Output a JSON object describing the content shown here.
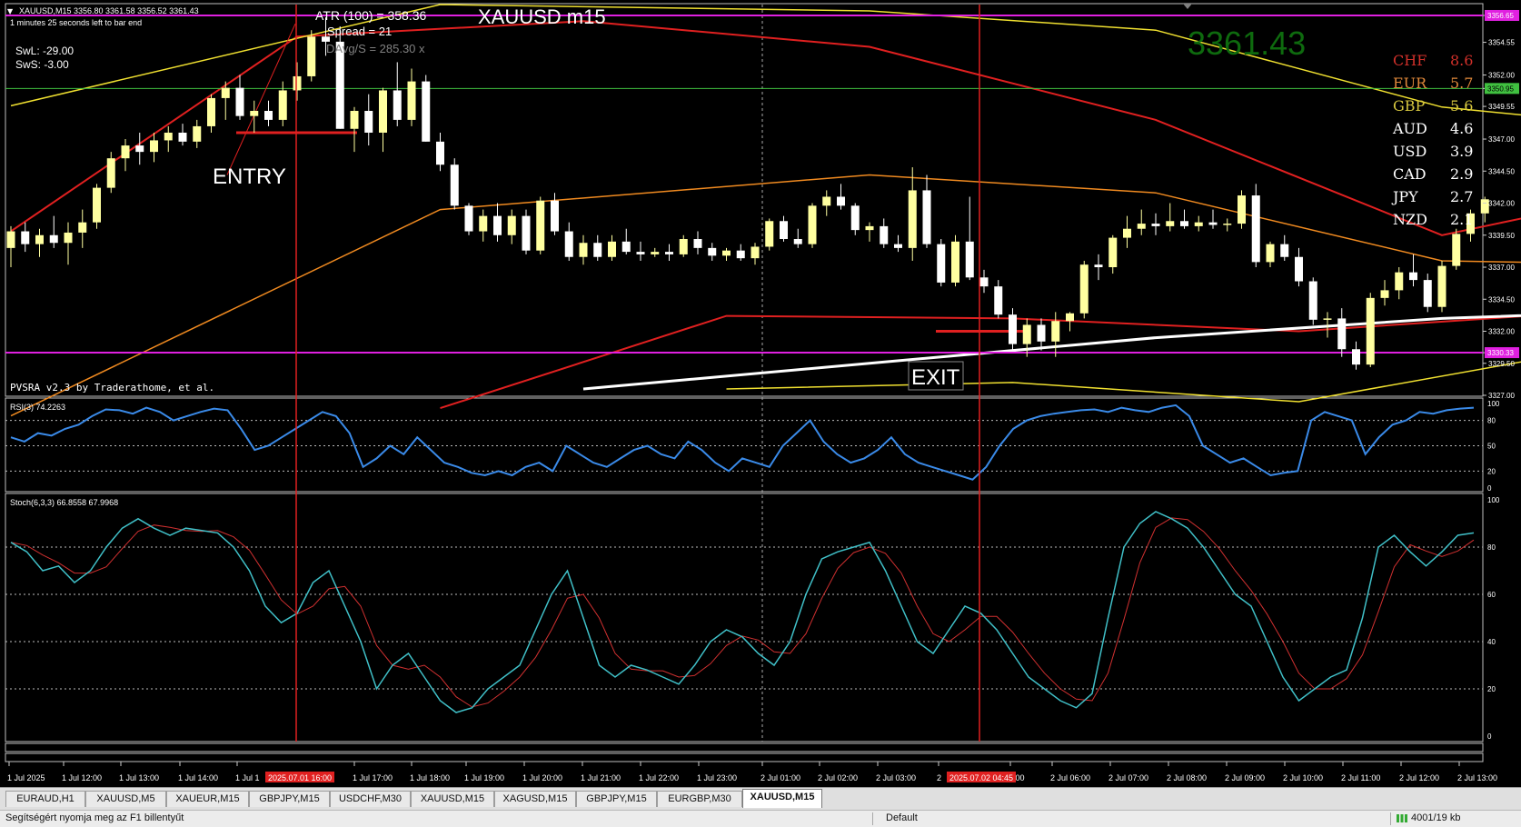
{
  "header": {
    "symbol_info": "XAUUSD,M15  3356.80 3361.58 3356.52 3361.43",
    "timer": "1 minutes 25 seconds left to bar end",
    "swl": "SwL:  -29.00",
    "sws": "SwS:  -3.00",
    "atr": "ATR (100) =  358.36",
    "spread": "Spread  =  21",
    "davg": "DAvg/S  =  285.30 x",
    "title": "XAUUSD m15",
    "big_price": "3361.43",
    "pvsra": "PVSRA v2.3 by Traderathome, et al."
  },
  "strength": [
    {
      "cur": "CHF",
      "val": "8.6",
      "color": "#d0302a"
    },
    {
      "cur": "EUR",
      "val": "5.7",
      "color": "#e0883a"
    },
    {
      "cur": "GBP",
      "val": "5.6",
      "color": "#d8c840"
    },
    {
      "cur": "AUD",
      "val": "4.6",
      "color": "#ffffff"
    },
    {
      "cur": "USD",
      "val": "3.9",
      "color": "#ffffff"
    },
    {
      "cur": "CAD",
      "val": "2.9",
      "color": "#ffffff"
    },
    {
      "cur": "JPY",
      "val": "2.7",
      "color": "#ffffff"
    },
    {
      "cur": "NZD",
      "val": "2.1",
      "color": "#ffffff"
    }
  ],
  "labels": {
    "entry": "ENTRY",
    "exit": "EXIT"
  },
  "price_axis": [
    "3356.65",
    "3354.55",
    "3352.00",
    "3350.95",
    "3349.55",
    "3347.00",
    "3344.50",
    "3342.00",
    "3339.50",
    "3337.00",
    "3334.50",
    "3332.00",
    "3330.33",
    "3329.50",
    "3327.00"
  ],
  "price_badges": {
    "magenta_top": "3356.65",
    "green": "3350.95",
    "magenta_bottom": "3330.33"
  },
  "rsi": {
    "label": "RSI(3) 74.2263",
    "levels": [
      "100",
      "80",
      "50",
      "20",
      "0"
    ]
  },
  "stoch": {
    "label": "Stoch(6,3,3) 66.8558 67.9968",
    "levels": [
      "100",
      "80",
      "60",
      "40",
      "20",
      "0"
    ]
  },
  "time_axis": [
    "1 Jul 2025",
    "1 Jul 12:00",
    "1 Jul 13:00",
    "1 Jul 14:00",
    "1 Jul 1",
    "1 Jul 17:00",
    "1 Jul 18:00",
    "1 Jul 19:00",
    "1 Jul 20:00",
    "1 Jul 21:00",
    "1 Jul 22:00",
    "1 Jul 23:00",
    "2 Jul 01:00",
    "2 Jul 02:00",
    "2 Jul 03:00",
    "2",
    "5:00",
    "2 Jul 06:00",
    "2 Jul 07:00",
    "2 Jul 08:00",
    "2 Jul 09:00",
    "2 Jul 10:00",
    "2 Jul 11:00",
    "2 Jul 12:00",
    "2 Jul 13:00"
  ],
  "time_badges": {
    "entry": "2025.07.01 16:00",
    "exit": "2025.07.02 04:45"
  },
  "tabs": [
    "EURAUD,H1",
    "XAUUSD,M5",
    "XAUEUR,M15",
    "GBPJPY,M15",
    "USDCHF,M30",
    "XAUUSD,M15",
    "XAGUSD,M15",
    "GBPJPY,M15",
    "EURGBP,M30",
    "XAUUSD,M15"
  ],
  "active_tab": 9,
  "status": {
    "help": "Segítségért nyomja meg az F1 billentyűt",
    "profile": "Default",
    "traffic": "4001/19 kb"
  },
  "colors": {
    "bull": "#ffffa0",
    "bear": "#ffffff",
    "red": "#e02020",
    "orange": "#f08a20",
    "yellow": "#f0e030",
    "white_ma": "#ffffff",
    "rsi": "#3a8ae8",
    "stoch_main": "#40c0c8",
    "stoch_signal": "#d03030",
    "magenta": "#e020e0",
    "green_line": "#40c040"
  },
  "chart_data": {
    "type": "candlestick",
    "symbol": "XAUUSD",
    "timeframe": "M15",
    "ylim": [
      3327.0,
      3357.5
    ],
    "candles": [
      [
        3338.5,
        3340.2,
        3337.0,
        3339.8
      ],
      [
        3339.8,
        3340.5,
        3338.2,
        3338.8
      ],
      [
        3338.8,
        3340.0,
        3337.8,
        3339.5
      ],
      [
        3339.5,
        3341.0,
        3338.5,
        3338.9
      ],
      [
        3338.9,
        3340.5,
        3337.2,
        3339.7
      ],
      [
        3339.7,
        3341.5,
        3338.5,
        3340.5
      ],
      [
        3340.5,
        3343.5,
        3340.0,
        3343.2
      ],
      [
        3343.2,
        3346.0,
        3342.8,
        3345.5
      ],
      [
        3345.5,
        3347.0,
        3344.5,
        3346.5
      ],
      [
        3346.5,
        3347.5,
        3345.0,
        3346.0
      ],
      [
        3346.0,
        3347.5,
        3345.2,
        3346.9
      ],
      [
        3346.9,
        3348.0,
        3346.0,
        3347.5
      ],
      [
        3347.5,
        3348.2,
        3346.5,
        3346.8
      ],
      [
        3346.8,
        3348.5,
        3346.3,
        3348.0
      ],
      [
        3348.0,
        3350.5,
        3347.5,
        3350.2
      ],
      [
        3350.2,
        3351.5,
        3348.5,
        3351.0
      ],
      [
        3351.0,
        3352.0,
        3348.5,
        3348.8
      ],
      [
        3348.8,
        3350.0,
        3347.5,
        3349.2
      ],
      [
        3349.2,
        3350.0,
        3348.0,
        3348.5
      ],
      [
        3348.5,
        3351.5,
        3348.0,
        3350.8
      ],
      [
        3350.8,
        3353.0,
        3350.0,
        3351.9
      ],
      [
        3351.9,
        3355.5,
        3351.5,
        3355.0
      ],
      [
        3355.0,
        3356.5,
        3353.5,
        3354.6
      ],
      [
        3354.6,
        3355.8,
        3347.8,
        3347.8
      ],
      [
        3347.8,
        3349.5,
        3346.0,
        3349.2
      ],
      [
        3349.2,
        3350.5,
        3346.5,
        3347.5
      ],
      [
        3347.5,
        3351.0,
        3346.0,
        3350.8
      ],
      [
        3350.8,
        3353.0,
        3348.0,
        3348.5
      ],
      [
        3348.5,
        3352.5,
        3348.0,
        3351.5
      ],
      [
        3351.5,
        3352.0,
        3346.8,
        3346.8
      ],
      [
        3346.8,
        3347.5,
        3344.5,
        3345.0
      ],
      [
        3345.0,
        3345.5,
        3341.5,
        3341.8
      ],
      [
        3341.8,
        3342.0,
        3339.5,
        3339.8
      ],
      [
        3339.8,
        3341.5,
        3339.0,
        3341.0
      ],
      [
        3341.0,
        3342.0,
        3339.0,
        3339.5
      ],
      [
        3339.5,
        3341.5,
        3338.8,
        3341.0
      ],
      [
        3341.0,
        3341.5,
        3338.0,
        3338.3
      ],
      [
        3338.3,
        3342.5,
        3338.0,
        3342.2
      ],
      [
        3342.2,
        3342.8,
        3339.5,
        3339.8
      ],
      [
        3339.8,
        3340.5,
        3337.5,
        3337.8
      ],
      [
        3337.8,
        3339.5,
        3337.2,
        3338.9
      ],
      [
        3338.9,
        3339.5,
        3337.5,
        3337.8
      ],
      [
        3337.8,
        3339.5,
        3337.5,
        3339.0
      ],
      [
        3339.0,
        3340.0,
        3338.0,
        3338.2
      ],
      [
        3338.2,
        3339.0,
        3337.5,
        3338.0
      ],
      [
        3338.0,
        3338.5,
        3337.8,
        3338.2
      ],
      [
        3338.2,
        3338.8,
        3337.5,
        3338.0
      ],
      [
        3338.0,
        3339.5,
        3337.8,
        3339.2
      ],
      [
        3339.2,
        3339.8,
        3338.0,
        3338.5
      ],
      [
        3338.5,
        3338.9,
        3337.5,
        3337.9
      ],
      [
        3337.9,
        3338.5,
        3337.5,
        3338.3
      ],
      [
        3338.3,
        3338.8,
        3337.5,
        3337.7
      ],
      [
        3337.7,
        3338.9,
        3337.2,
        3338.6
      ],
      [
        3338.6,
        3340.8,
        3338.3,
        3340.6
      ],
      [
        3340.6,
        3341.0,
        3339.0,
        3339.2
      ],
      [
        3339.2,
        3340.0,
        3338.5,
        3338.8
      ],
      [
        3338.8,
        3342.0,
        3338.5,
        3341.8
      ],
      [
        3341.8,
        3343.0,
        3341.0,
        3342.5
      ],
      [
        3342.5,
        3343.5,
        3341.5,
        3341.8
      ],
      [
        3341.8,
        3342.0,
        3339.5,
        3339.9
      ],
      [
        3339.9,
        3340.5,
        3339.0,
        3340.2
      ],
      [
        3340.2,
        3340.8,
        3338.5,
        3338.8
      ],
      [
        3338.8,
        3339.5,
        3338.2,
        3338.5
      ],
      [
        3338.5,
        3344.8,
        3337.5,
        3343.0
      ],
      [
        3343.0,
        3344.2,
        3338.5,
        3338.8
      ],
      [
        3338.8,
        3339.2,
        3335.5,
        3335.8
      ],
      [
        3335.8,
        3339.5,
        3335.5,
        3339.0
      ],
      [
        3339.0,
        3342.5,
        3336.0,
        3336.2
      ],
      [
        3336.2,
        3336.8,
        3335.0,
        3335.5
      ],
      [
        3335.5,
        3336.0,
        3333.0,
        3333.3
      ],
      [
        3333.3,
        3333.8,
        3330.5,
        3331.0
      ],
      [
        3331.0,
        3333.0,
        3330.0,
        3332.5
      ],
      [
        3332.5,
        3333.0,
        3330.5,
        3331.2
      ],
      [
        3331.2,
        3333.5,
        3330.0,
        3332.8
      ],
      [
        3332.8,
        3333.5,
        3332.0,
        3333.4
      ],
      [
        3333.4,
        3337.5,
        3333.0,
        3337.2
      ],
      [
        3337.2,
        3338.0,
        3336.0,
        3337.0
      ],
      [
        3337.0,
        3339.5,
        3336.5,
        3339.3
      ],
      [
        3339.3,
        3341.0,
        3338.5,
        3340.0
      ],
      [
        3340.0,
        3341.5,
        3339.5,
        3340.4
      ],
      [
        3340.4,
        3341.2,
        3339.5,
        3340.2
      ],
      [
        3340.2,
        3342.0,
        3339.8,
        3340.6
      ],
      [
        3340.6,
        3341.5,
        3340.0,
        3340.2
      ],
      [
        3340.2,
        3341.0,
        3339.8,
        3340.5
      ],
      [
        3340.5,
        3341.5,
        3340.0,
        3340.3
      ],
      [
        3340.3,
        3340.8,
        3339.8,
        3340.4
      ],
      [
        3340.4,
        3343.0,
        3340.0,
        3342.6
      ],
      [
        3342.6,
        3343.5,
        3337.0,
        3337.4
      ],
      [
        3337.4,
        3339.0,
        3337.0,
        3338.8
      ],
      [
        3338.8,
        3339.5,
        3337.5,
        3337.8
      ],
      [
        3337.8,
        3338.5,
        3335.5,
        3335.9
      ],
      [
        3335.9,
        3336.2,
        3332.5,
        3332.9
      ],
      [
        3332.9,
        3333.5,
        3331.5,
        3333.0
      ],
      [
        3333.0,
        3333.8,
        3330.0,
        3330.6
      ],
      [
        3330.6,
        3331.2,
        3329.0,
        3329.4
      ],
      [
        3329.4,
        3335.0,
        3329.2,
        3334.6
      ],
      [
        3334.6,
        3336.0,
        3334.0,
        3335.2
      ],
      [
        3335.2,
        3337.0,
        3334.5,
        3336.6
      ],
      [
        3336.6,
        3338.0,
        3335.5,
        3336.0
      ],
      [
        3336.0,
        3336.5,
        3333.5,
        3333.9
      ],
      [
        3333.9,
        3337.5,
        3333.5,
        3337.1
      ],
      [
        3337.1,
        3340.0,
        3336.8,
        3339.6
      ],
      [
        3339.6,
        3341.5,
        3339.0,
        3341.2
      ],
      [
        3341.2,
        3342.5,
        3340.5,
        3342.3
      ]
    ],
    "ma_orange": [
      [
        0,
        3325.4
      ],
      [
        30,
        3341.5
      ],
      [
        60,
        3344.2
      ],
      [
        80,
        3342.8
      ],
      [
        100,
        3337.5
      ],
      [
        110,
        3337.3
      ],
      [
        135,
        3338.6
      ],
      [
        150,
        3337.0
      ]
    ],
    "ma_red_inner": [
      [
        0,
        3339.8
      ],
      [
        20,
        3355.0
      ],
      [
        40,
        3356.2
      ],
      [
        60,
        3354.2
      ],
      [
        80,
        3348.5
      ],
      [
        100,
        3339.5
      ],
      [
        120,
        3344.2
      ],
      [
        150,
        3345.2
      ]
    ],
    "ma_red_outer": [
      [
        30,
        3326.0
      ],
      [
        50,
        3333.2
      ],
      [
        70,
        3333.0
      ],
      [
        90,
        3332.0
      ],
      [
        110,
        3333.5
      ],
      [
        130,
        3331.0
      ],
      [
        150,
        3330.3
      ]
    ],
    "ma_yellow_upper": [
      [
        0,
        3349.6
      ],
      [
        30,
        3357.5
      ],
      [
        60,
        3357.0
      ],
      [
        80,
        3355.5
      ],
      [
        100,
        3349.5
      ],
      [
        120,
        3347.3
      ],
      [
        150,
        3348.0
      ]
    ],
    "ma_yellow_lower": [
      [
        50,
        3327.5
      ],
      [
        70,
        3328.0
      ],
      [
        90,
        3326.5
      ],
      [
        110,
        3330.5
      ],
      [
        130,
        3330.0
      ],
      [
        150,
        3327.0
      ]
    ],
    "ma_white": [
      [
        40,
        3327.5
      ],
      [
        60,
        3329.5
      ],
      [
        80,
        3331.5
      ],
      [
        100,
        3333.0
      ],
      [
        120,
        3333.8
      ],
      [
        150,
        3334.8
      ]
    ],
    "lines": {
      "magenta_top": 3356.65,
      "green": 3350.95,
      "magenta_bottom": 3330.33,
      "entry_price": 3347.5,
      "exit_price": 3332.0
    },
    "rsi_values": [
      60,
      55,
      65,
      62,
      70,
      75,
      85,
      93,
      92,
      88,
      95,
      90,
      80,
      85,
      90,
      94,
      92,
      70,
      45,
      50,
      60,
      70,
      80,
      90,
      85,
      65,
      25,
      35,
      50,
      40,
      60,
      45,
      30,
      25,
      18,
      15,
      20,
      15,
      25,
      30,
      20,
      50,
      40,
      30,
      25,
      35,
      45,
      50,
      40,
      35,
      55,
      45,
      30,
      20,
      35,
      30,
      25,
      50,
      65,
      80,
      55,
      40,
      30,
      35,
      45,
      60,
      40,
      30,
      25,
      20,
      15,
      10,
      25,
      50,
      70,
      80,
      85,
      88,
      90,
      92,
      93,
      90,
      95,
      92,
      90,
      95,
      98,
      85,
      50,
      40,
      30,
      35,
      25,
      15,
      18,
      20,
      80,
      90,
      85,
      80,
      40,
      60,
      75,
      80,
      90,
      88,
      92,
      94,
      95
    ]
  }
}
